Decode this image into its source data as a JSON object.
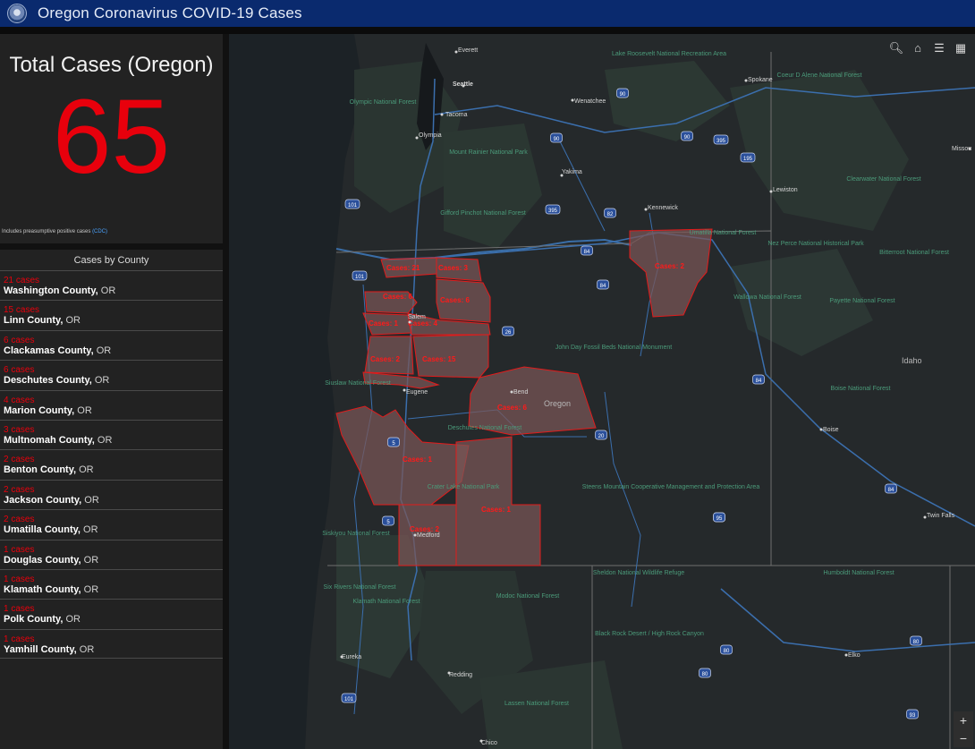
{
  "header": {
    "title": "Oregon Coronavirus COVID-19 Cases"
  },
  "total": {
    "title": "Total Cases (Oregon)",
    "value": "65",
    "note_text": "Includes preasumptive positive cases ",
    "note_link": "(CDC)"
  },
  "counties": {
    "title": "Cases by County",
    "state_suffix": "OR",
    "items": [
      {
        "cases": "21 cases",
        "name": "Washington County,"
      },
      {
        "cases": "15 cases",
        "name": "Linn County,"
      },
      {
        "cases": "6 cases",
        "name": "Clackamas County,"
      },
      {
        "cases": "6 cases",
        "name": "Deschutes County,"
      },
      {
        "cases": "4 cases",
        "name": "Marion County,"
      },
      {
        "cases": "3 cases",
        "name": "Multnomah County,"
      },
      {
        "cases": "2 cases",
        "name": "Benton County,"
      },
      {
        "cases": "2 cases",
        "name": "Jackson County,"
      },
      {
        "cases": "2 cases",
        "name": "Umatilla County,"
      },
      {
        "cases": "1 cases",
        "name": "Douglas County,"
      },
      {
        "cases": "1 cases",
        "name": "Klamath County,"
      },
      {
        "cases": "1 cases",
        "name": "Polk County,"
      },
      {
        "cases": "1 cases",
        "name": "Yamhill County,"
      }
    ]
  },
  "map": {
    "case_labels": [
      "Cases: 21",
      "Cases: 3",
      "Cases: 6",
      "Cases: 6",
      "Cases: 1",
      "Cases: 4",
      "Cases: 2",
      "Cases: 15",
      "Cases: 6",
      "Cases: 1",
      "Cases: 1",
      "Cases: 2",
      "Cases: 2"
    ],
    "cities": [
      "Everett",
      "Seattle",
      "Tacoma",
      "Olympia",
      "Wenatchee",
      "Spokane",
      "Yakima",
      "Kennewick",
      "Lewiston",
      "Salem",
      "Eugene",
      "Bend",
      "Boise",
      "Twin Falls",
      "Medford",
      "Eureka",
      "Redding",
      "Elko",
      "Chico",
      "Missou"
    ],
    "states": [
      "Oregon",
      "Idaho"
    ],
    "places": [
      "Lake Roosevelt National Recreation Area",
      "Olympic National Forest",
      "Mount Rainier National Park",
      "Gifford Pinchot National Forest",
      "Umatilla National Forest",
      "Nez Perce National Historical Park",
      "Coeur D Alene National Forest",
      "Clearwater National Forest",
      "Bitterroot National Forest",
      "Wallowa National Forest",
      "Payette National Forest",
      "John Day Fossil Beds National Monument",
      "Siuslaw National Forest",
      "Deschutes National Forest",
      "Boise National Forest",
      "Crater Lake National Park",
      "Steens Mountain Cooperative Management and Protection Area",
      "Siskiyou National Forest",
      "Six Rivers National Forest",
      "Klamath National Forest",
      "Modoc National Forest",
      "Sheldon National Wildlife Refuge",
      "Humboldt National Forest",
      "Black Rock Desert / High Rock Canyon",
      "Lassen National Forest"
    ],
    "highways": [
      "5",
      "84",
      "90",
      "395",
      "82",
      "101",
      "26",
      "20",
      "97",
      "95",
      "80",
      "93",
      "195"
    ],
    "toolbar": {
      "search": "search-icon",
      "home": "home-icon",
      "legend": "legend-icon",
      "basemap": "basemap-icon"
    },
    "zoom_in": "+",
    "zoom_out": "−"
  }
}
